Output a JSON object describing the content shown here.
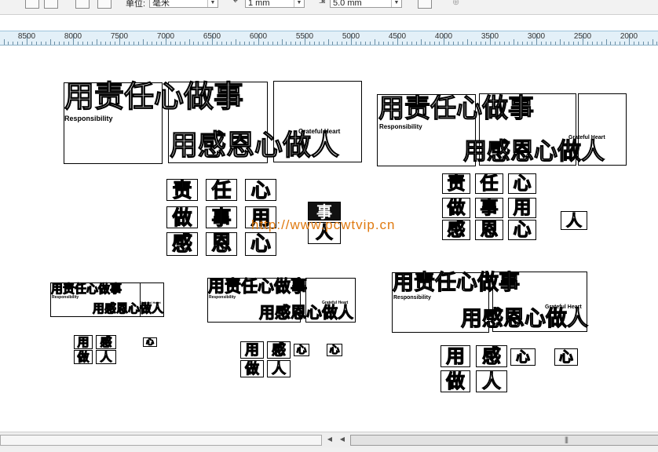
{
  "toolbar": {
    "units_label": "单位:",
    "units_value": "毫米",
    "nudge_value": "1 mm",
    "duplicate_value": "5.0 mm"
  },
  "ruler": {
    "labels": [
      "8500",
      "8000",
      "7500",
      "7000",
      "6500",
      "6000",
      "5500",
      "5000",
      "4500",
      "4000",
      "3500",
      "3000",
      "2500",
      "2000"
    ]
  },
  "artwork": {
    "line1": "用责任心做事",
    "line2": "用感恩心做人",
    "english1": "Responsibility",
    "english2": "Grateful Heart"
  },
  "seals": {
    "big_set": [
      "责",
      "任",
      "心",
      "做",
      "事",
      "用",
      "感",
      "恩",
      "心"
    ],
    "small_set": [
      "用",
      "感",
      "心",
      "做",
      "人"
    ],
    "odd": "事",
    "small_word": "人"
  },
  "watermark": "http://www.pcwtvip.cn",
  "scroll": {
    "grip": "|||"
  }
}
